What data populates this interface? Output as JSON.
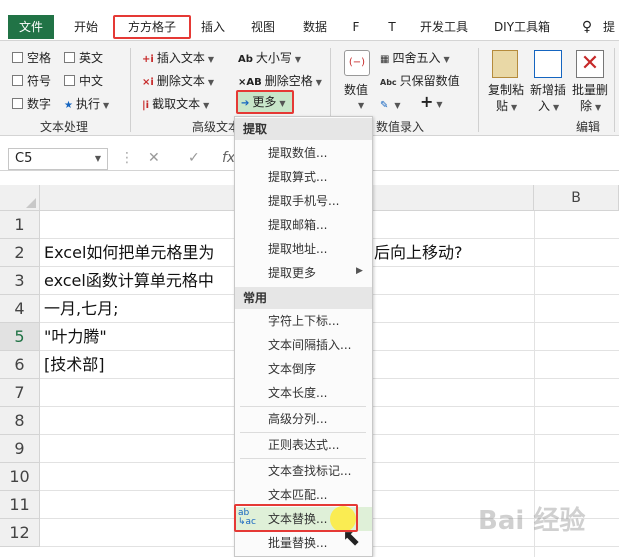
{
  "tabs": {
    "file": "文件",
    "items": [
      {
        "label": "开始"
      },
      {
        "label": "方方格子"
      },
      {
        "label": "插入"
      },
      {
        "label": "视图"
      },
      {
        "label": "数据"
      },
      {
        "label": "F"
      },
      {
        "label": "T"
      },
      {
        "label": "开发工具"
      },
      {
        "label": "DIY工具箱"
      },
      {
        "label": "提"
      }
    ]
  },
  "ribbon": {
    "text_processing": {
      "checkboxes": [
        "空格",
        "英文",
        "符号",
        "中文",
        "数字"
      ],
      "execute": "执行",
      "group_label": "文本处理"
    },
    "advanced_text": {
      "insert_text": "插入文本",
      "delete_text": "删除文本",
      "extract_text": "截取文本",
      "case": "大小写",
      "delete_spaces": "删除空格",
      "more": "更多",
      "group_label": "高级文本"
    },
    "number_entry": {
      "value": "数值",
      "round": "四舍五入",
      "keep_value": "只保留数值",
      "plus": "+",
      "group_label": "数值录入"
    },
    "edit": {
      "copy_paste_1": "复制粘",
      "copy_paste_2": "贴",
      "new_insert_1": "新增插",
      "new_insert_2": "入",
      "batch_delete_1": "批量删",
      "batch_delete_2": "除",
      "group_label": "编辑"
    }
  },
  "formula_bar": {
    "name_box": "C5",
    "fx": "fx"
  },
  "sheet": {
    "col_b": "B",
    "rows": [
      "1",
      "2",
      "3",
      "4",
      "5",
      "6",
      "7",
      "8",
      "9",
      "10",
      "11",
      "12"
    ],
    "cells": {
      "r2": "Excel如何把单元格里为",
      "r2_tail": "后向上移动?",
      "r3": "excel函数计算单元格中",
      "r4": "一月,七月;",
      "r5": "\"叶力腾\"",
      "r6": "[技术部]"
    }
  },
  "menu": {
    "section_extract": "提取",
    "extract_items": [
      "提取数值...",
      "提取算式...",
      "提取手机号...",
      "提取邮箱...",
      "提取地址...",
      "提取更多"
    ],
    "section_common": "常用",
    "common_items": [
      "字符上下标...",
      "文本间隔插入...",
      "文本倒序",
      "文本长度...",
      "高级分列...",
      "正则表达式...",
      "文本查找标记...",
      "文本匹配...",
      "文本替换...",
      "批量替换..."
    ]
  },
  "watermark": "Bai 经验",
  "accent_colors": {
    "excel_green": "#217346",
    "highlight_red": "#e53935"
  }
}
